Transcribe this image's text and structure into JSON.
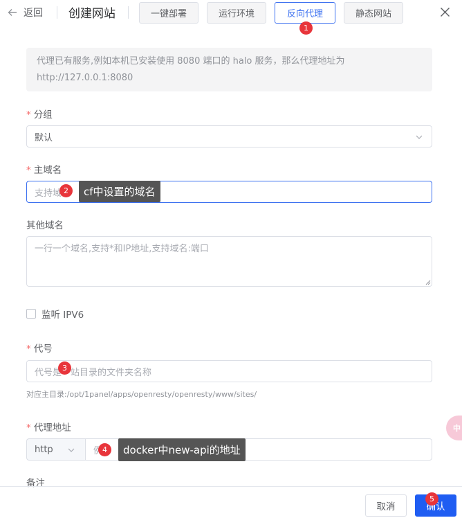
{
  "header": {
    "back_label": "返回",
    "title": "创建网站",
    "tabs": [
      {
        "label": "一键部署",
        "active": false
      },
      {
        "label": "运行环境",
        "active": false
      },
      {
        "label": "反向代理",
        "active": true
      },
      {
        "label": "静态网站",
        "active": false
      }
    ]
  },
  "notice": "代理已有服务,例如本机已安装使用 8080 端口的 halo 服务，那么代理地址为 http://127.0.0.1:8080",
  "form": {
    "group": {
      "label": "分组",
      "required": "*",
      "value": "默认"
    },
    "domain": {
      "label": "主域名",
      "required": "*",
      "placeholder": "支持域"
    },
    "other_domains": {
      "label": "其他域名",
      "placeholder": "一行一个域名,支持*和IP地址,支持域名:端口"
    },
    "ipv6": {
      "label": "监听 IPV6",
      "checked": false
    },
    "alias": {
      "label": "代号",
      "required": "*",
      "placeholder": "代号是",
      "placeholder_tail": "站目录的文件夹名称",
      "hint": "对应主目录:/opt/1panel/apps/openresty/openresty/www/sites/"
    },
    "proxy": {
      "label": "代理地址",
      "required": "*",
      "protocol": "http",
      "placeholder": "例"
    },
    "remark": {
      "label": "备注"
    }
  },
  "annotations": {
    "badges": [
      "1",
      "2",
      "3",
      "4",
      "5"
    ],
    "tooltip_domain": "cf中设置的域名",
    "tooltip_proxy": "docker中new-api的地址"
  },
  "footer": {
    "cancel_label": "取消",
    "confirm_label": "确认"
  },
  "side_widget": {
    "text": "中"
  },
  "colors": {
    "accent": "#3a6ff0",
    "primary_button": "#1f5df2",
    "badge": "#e8353b",
    "required": "#f56c6c",
    "tooltip_bg": "#555555"
  }
}
